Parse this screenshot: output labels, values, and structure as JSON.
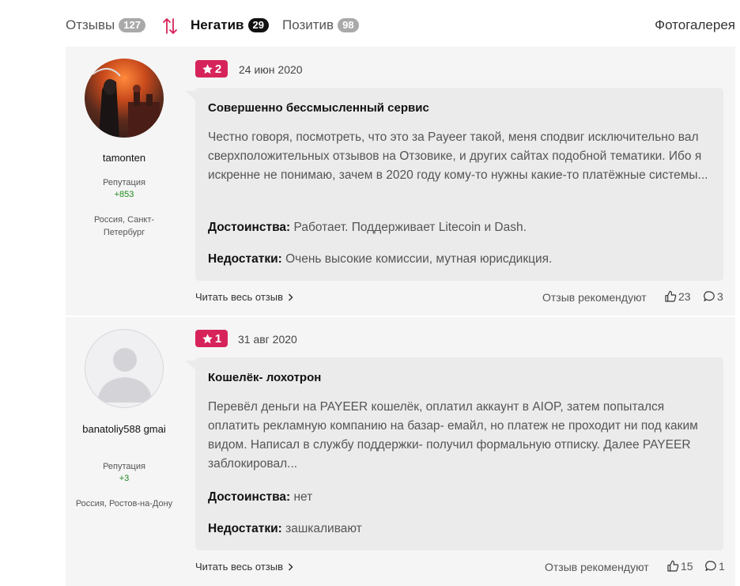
{
  "tabs": [
    {
      "label": "Отзывы",
      "count": "127"
    },
    {
      "label": "Негатив",
      "count": "29"
    },
    {
      "label": "Позитив",
      "count": "98"
    }
  ],
  "gallery_label": "Фотогалерея",
  "colors": {
    "rating_bg": "#d6245a",
    "reputation": "#1e8a1e",
    "active_badge": "#111111",
    "inactive_badge": "#a9a9a9"
  },
  "reviews": [
    {
      "author": {
        "name": "tamonten",
        "reputation_label": "Репутация",
        "reputation": "+853",
        "location": "Россия, Санкт-Петербург",
        "avatar": "photo"
      },
      "rating": "2",
      "date": "24 июн 2020",
      "title": "Совершенно бессмысленный сервис",
      "text": "Честно говоря, посмотреть, что это за Payeer такой, меня сподвиг исключительно вал сверхположительных отзывов на Отзовике, и других сайтах подобной тематики. Ибо я искренне не понимаю, зачем в 2020 году кому-то нужны какие-то платёжные системы...",
      "pros_label": "Достоинства:",
      "pros": "Работает. Поддерживает Litecoin и Dash.",
      "cons_label": "Недостатки:",
      "cons": "Очень высокие комиссии, мутная юрисдикция.",
      "read_more": "Читать весь отзыв",
      "recommend_label": "Отзыв рекомендуют",
      "likes": "23",
      "comments": "3"
    },
    {
      "author": {
        "name": "banatoliy588 gmai",
        "reputation_label": "Репутация",
        "reputation": "+3",
        "location": "Россия, Ростов-на-Дону",
        "avatar": "placeholder"
      },
      "rating": "1",
      "date": "31 авг 2020",
      "title": "Кошелёк- лохотрон",
      "text": "Перевёл деньги на PAYEER кошелёк, оплатил аккаунт в AIOP, затем попытался оплатить рекламную компанию на базар- емайл, но платеж не проходит ни под каким видом. Написал в службу поддержки- получил формальную отписку. Далее PAYEER заблокировал...",
      "pros_label": "Достоинства:",
      "pros": "нет",
      "cons_label": "Недостатки:",
      "cons": "зашкаливают",
      "read_more": "Читать весь отзыв",
      "recommend_label": "Отзыв рекомендуют",
      "likes": "15",
      "comments": "1"
    }
  ]
}
